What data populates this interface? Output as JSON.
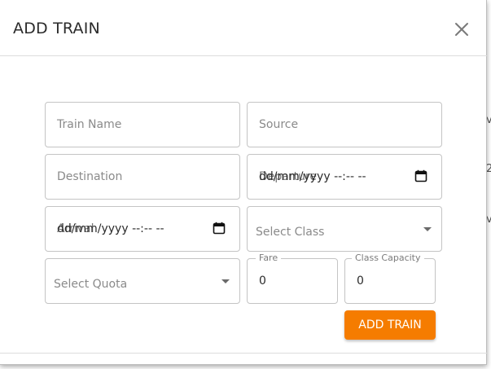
{
  "dialog": {
    "title": "ADD TRAIN",
    "close_icon": "close-icon"
  },
  "form": {
    "train_name": {
      "placeholder": "Train Name",
      "value": ""
    },
    "source": {
      "placeholder": "Source",
      "value": ""
    },
    "destination": {
      "placeholder": "Destination",
      "value": ""
    },
    "departure": {
      "label": "Departure",
      "format": "dd/mm/yyyy --:-- --"
    },
    "arrival": {
      "label": "Arrival",
      "format": "dd/mm/yyyy --:-- --"
    },
    "class_select": {
      "placeholder": "Select Class"
    },
    "quota_select": {
      "placeholder": "Select Quota"
    },
    "fare": {
      "label": "Fare",
      "value": "0"
    },
    "class_capacity": {
      "label": "Class Capacity",
      "value": "0"
    },
    "submit_label": "ADD TRAIN"
  },
  "colors": {
    "accent": "#f57c00",
    "border": "#c4c4c4",
    "placeholder": "#8a8a8a"
  }
}
